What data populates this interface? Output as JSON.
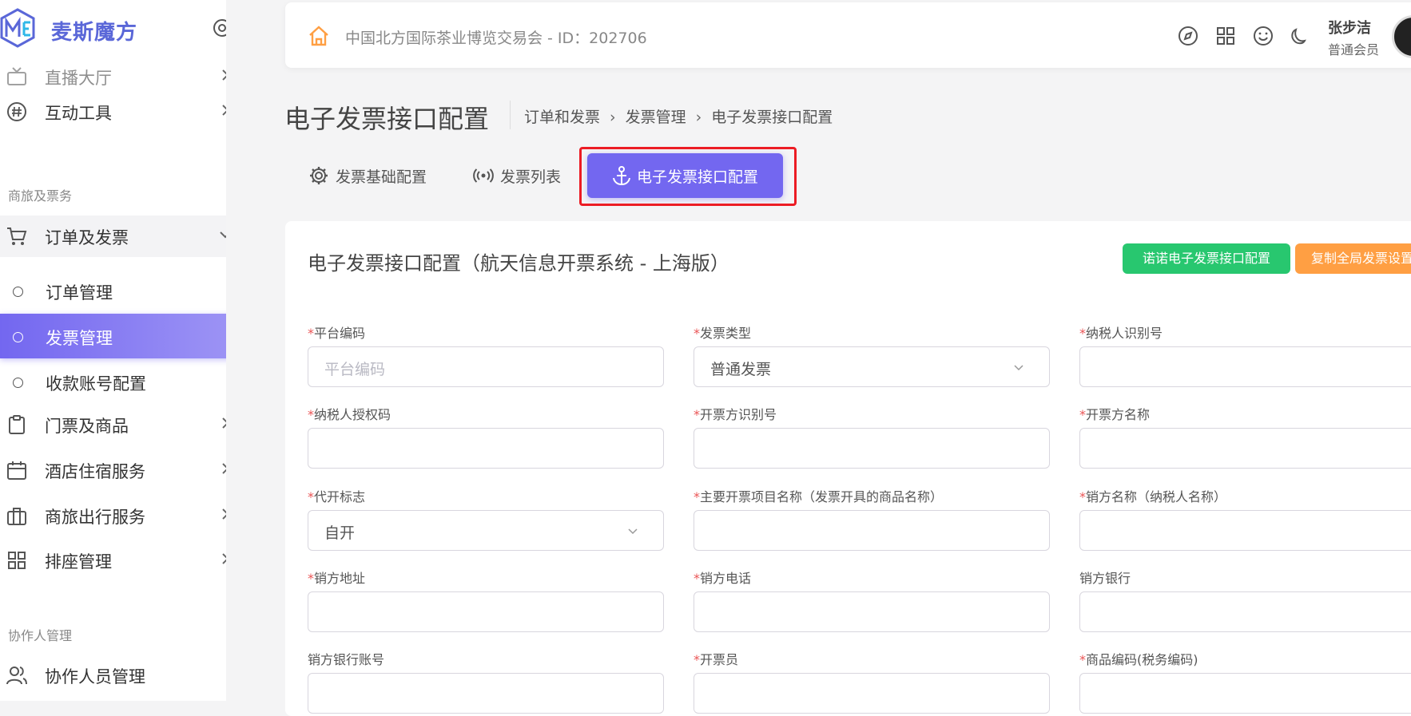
{
  "brand": {
    "name": "麦斯魔方"
  },
  "sidebar": {
    "items_top": [
      {
        "label": "直播大厅",
        "icon": "tv-icon"
      },
      {
        "label": "互动工具",
        "icon": "hash-icon"
      }
    ],
    "section1": "商旅及票务",
    "order_group": {
      "label": "订单及发票",
      "icon": "cart-icon"
    },
    "sub_items": [
      {
        "label": "订单管理"
      },
      {
        "label": "发票管理"
      },
      {
        "label": "收款账号配置"
      }
    ],
    "items_mid": [
      {
        "label": "门票及商品",
        "icon": "clipboard-icon"
      },
      {
        "label": "酒店住宿服务",
        "icon": "calendar-icon"
      },
      {
        "label": "商旅出行服务",
        "icon": "briefcase-icon"
      },
      {
        "label": "排座管理",
        "icon": "grid-icon"
      }
    ],
    "section2": "协作人管理",
    "items_bottom": [
      {
        "label": "协作人员管理",
        "icon": "users-icon"
      }
    ]
  },
  "header": {
    "event_title": "中国北方国际茶业博览交易会 - ID：202706",
    "user_name": "张步洁",
    "user_role": "普通会员"
  },
  "page": {
    "title": "电子发票接口配置",
    "breadcrumbs": [
      "订单和发票",
      "发票管理",
      "电子发票接口配置"
    ]
  },
  "tabs": [
    {
      "label": "发票基础配置",
      "icon": "gear-icon"
    },
    {
      "label": "发票列表",
      "icon": "broadcast-icon"
    },
    {
      "label": "电子发票接口配置",
      "icon": "anchor-icon"
    }
  ],
  "card": {
    "title": "电子发票接口配置（航天信息开票系统 - 上海版）",
    "btn_nuonuo": "诺诺电子发票接口配置",
    "btn_copy": "复制全局发票设置",
    "fields": [
      {
        "label": "平台编码",
        "required": "*",
        "value": "",
        "placeholder": "平台编码"
      },
      {
        "label": "发票类型",
        "required": "*",
        "value": "普通发票",
        "placeholder": ""
      },
      {
        "label": "纳税人识别号",
        "required": "*",
        "value": "",
        "placeholder": ""
      },
      {
        "label": "纳税人授权码",
        "required": "*",
        "value": "",
        "placeholder": ""
      },
      {
        "label": "开票方识别号",
        "required": "*",
        "value": "",
        "placeholder": ""
      },
      {
        "label": "开票方名称",
        "required": "*",
        "value": "",
        "placeholder": ""
      },
      {
        "label": "代开标志",
        "required": "*",
        "value": "自开",
        "placeholder": ""
      },
      {
        "label": "主要开票项目名称（发票开具的商品名称）",
        "required": "*",
        "value": "",
        "placeholder": ""
      },
      {
        "label": "销方名称（纳税人名称）",
        "required": "*",
        "value": "",
        "placeholder": ""
      },
      {
        "label": "销方地址",
        "required": "*",
        "value": "",
        "placeholder": ""
      },
      {
        "label": "销方电话",
        "required": "*",
        "value": "",
        "placeholder": ""
      },
      {
        "label": "销方银行",
        "required": "",
        "value": "",
        "placeholder": ""
      },
      {
        "label": "销方银行账号",
        "required": "",
        "value": "",
        "placeholder": ""
      },
      {
        "label": "开票员",
        "required": "*",
        "value": "",
        "placeholder": ""
      },
      {
        "label": "商品编码(税务编码)",
        "required": "*",
        "value": "",
        "placeholder": ""
      }
    ]
  },
  "colors": {
    "accent": "#7367f0",
    "success": "#28c76f",
    "warning": "#ff9f43",
    "highlight": "#ec1c24"
  }
}
